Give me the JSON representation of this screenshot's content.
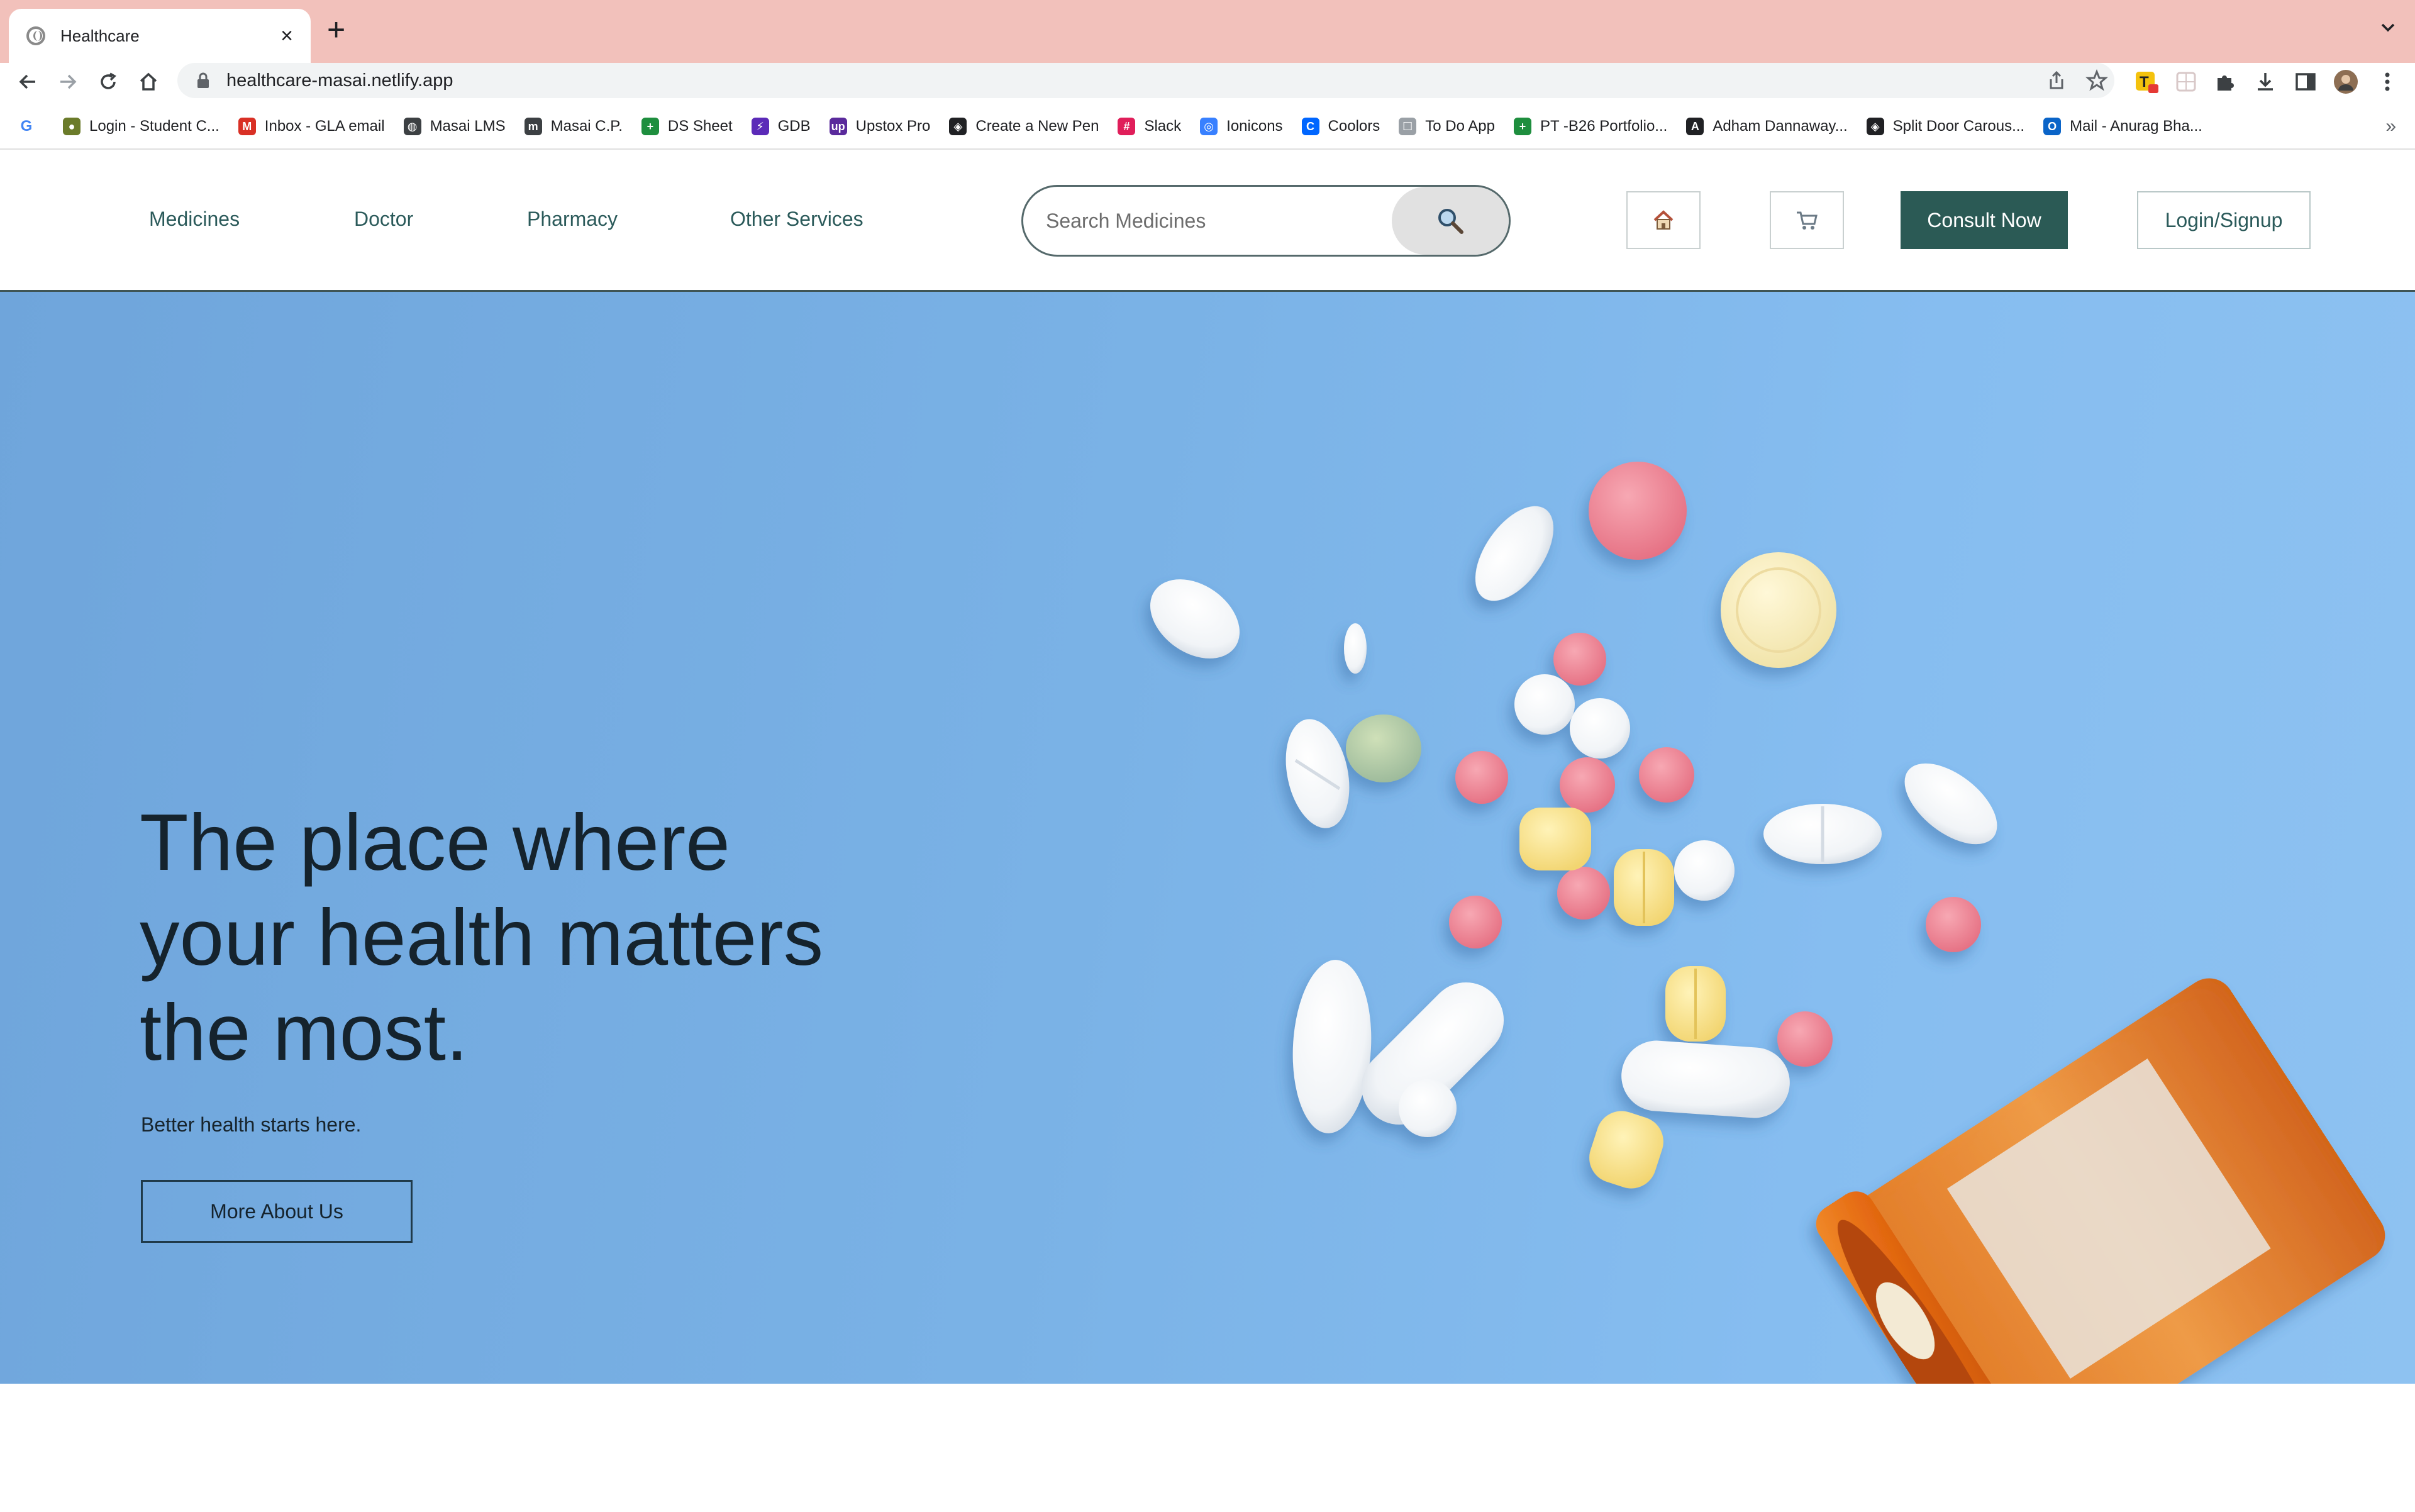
{
  "browser": {
    "tab_title": "Healthcare",
    "url": "healthcare-masai.netlify.app",
    "bookmarks": [
      {
        "label": "Login - Student C...",
        "icon": "frog-icon",
        "color": "#6b7b2a"
      },
      {
        "label": "Inbox - GLA email",
        "icon": "gmail-icon",
        "color": "#d93025"
      },
      {
        "label": "Masai LMS",
        "icon": "globe-icon",
        "color": "#3c4043"
      },
      {
        "label": "Masai C.P.",
        "icon": "masai-m-icon",
        "color": "#3c4043"
      },
      {
        "label": "DS Sheet",
        "icon": "sheets-icon",
        "color": "#1e8e3e"
      },
      {
        "label": "GDB",
        "icon": "gdb-icon",
        "color": "#5b2ab8"
      },
      {
        "label": "Upstox Pro",
        "icon": "upstox-icon",
        "color": "#5a2a9c"
      },
      {
        "label": "Create a New Pen",
        "icon": "codepen-icon",
        "color": "#202124"
      },
      {
        "label": "Slack",
        "icon": "slack-icon",
        "color": "#e01e5a"
      },
      {
        "label": "Ionicons",
        "icon": "ionicons-icon",
        "color": "#3880ff"
      },
      {
        "label": "Coolors",
        "icon": "coolors-icon",
        "color": "#0066ff"
      },
      {
        "label": "To Do App",
        "icon": "todo-icon",
        "color": "#9aa0a6"
      },
      {
        "label": "PT -B26 Portfolio...",
        "icon": "sheets-icon",
        "color": "#1e8e3e"
      },
      {
        "label": "Adham Dannaway...",
        "icon": "adham-icon",
        "color": "#202124"
      },
      {
        "label": "Split Door Carous...",
        "icon": "codepen-icon",
        "color": "#202124"
      },
      {
        "label": "Mail - Anurag Bha...",
        "icon": "outlook-icon",
        "color": "#0a64c8"
      }
    ]
  },
  "site": {
    "nav": [
      "Medicines",
      "Doctor",
      "Pharmacy",
      "Other Services"
    ],
    "search_placeholder": "Search Medicines",
    "consult_label": "Consult Now",
    "login_label": "Login/Signup"
  },
  "hero": {
    "headline_lines": [
      "The place where",
      "your health matters",
      "the most."
    ],
    "subtext": "Better health starts here.",
    "cta_label": "More About Us"
  },
  "colors": {
    "accent": "#2b5a55",
    "tabstrip": "#f2c1bb",
    "hero_blue": "#7ab2e6"
  }
}
